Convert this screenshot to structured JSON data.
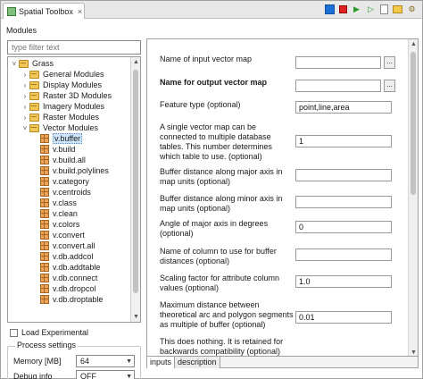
{
  "window": {
    "title": "Spatial Toolbox",
    "close": "×"
  },
  "toolbar_icons": [
    "select-icon",
    "stop-icon",
    "run-icon",
    "run-console-icon",
    "document-icon",
    "folder-icon",
    "gear-icon"
  ],
  "left": {
    "modules_label": "Modules",
    "filter_placeholder": "type filter text",
    "tree": [
      {
        "label": "Grass",
        "level": 0,
        "kind": "folder",
        "expanded": true
      },
      {
        "label": "General Modules",
        "level": 1,
        "kind": "folder",
        "expanded": false
      },
      {
        "label": "Display Modules",
        "level": 1,
        "kind": "folder",
        "expanded": false
      },
      {
        "label": "Raster 3D Modules",
        "level": 1,
        "kind": "folder",
        "expanded": false
      },
      {
        "label": "Imagery Modules",
        "level": 1,
        "kind": "folder",
        "expanded": false
      },
      {
        "label": "Raster Modules",
        "level": 1,
        "kind": "folder",
        "expanded": false
      },
      {
        "label": "Vector Modules",
        "level": 1,
        "kind": "folder",
        "expanded": true
      },
      {
        "label": "v.buffer",
        "level": 2,
        "kind": "module",
        "selected": true
      },
      {
        "label": "v.build",
        "level": 2,
        "kind": "module"
      },
      {
        "label": "v.build.all",
        "level": 2,
        "kind": "module"
      },
      {
        "label": "v.build.polylines",
        "level": 2,
        "kind": "module"
      },
      {
        "label": "v.category",
        "level": 2,
        "kind": "module"
      },
      {
        "label": "v.centroids",
        "level": 2,
        "kind": "module"
      },
      {
        "label": "v.class",
        "level": 2,
        "kind": "module"
      },
      {
        "label": "v.clean",
        "level": 2,
        "kind": "module"
      },
      {
        "label": "v.colors",
        "level": 2,
        "kind": "module"
      },
      {
        "label": "v.convert",
        "level": 2,
        "kind": "module"
      },
      {
        "label": "v.convert.all",
        "level": 2,
        "kind": "module"
      },
      {
        "label": "v.db.addcol",
        "level": 2,
        "kind": "module"
      },
      {
        "label": "v.db.addtable",
        "level": 2,
        "kind": "module"
      },
      {
        "label": "v.db.connect",
        "level": 2,
        "kind": "module"
      },
      {
        "label": "v.db.dropcol",
        "level": 2,
        "kind": "module"
      },
      {
        "label": "v.db.droptable",
        "level": 2,
        "kind": "module"
      }
    ],
    "load_experimental": "Load Experimental",
    "process_settings": "Process settings",
    "memory_label": "Memory [MB]",
    "memory_value": "64",
    "debug_label": "Debug info",
    "debug_value": "OFF"
  },
  "params": [
    {
      "label": "Name of input vector map",
      "value": "",
      "browse": true,
      "bold": false
    },
    {
      "label": "Name for output vector map",
      "value": "",
      "browse": true,
      "bold": true
    },
    {
      "label": "Feature type (optional)",
      "value": "point,line,area",
      "browse": false,
      "bold": false
    },
    {
      "label": "A single vector map can be connected to multiple database tables. This number determines which table to use. (optional)",
      "value": "1",
      "browse": false,
      "bold": false
    },
    {
      "label": "Buffer distance along major axis in map units (optional)",
      "value": "",
      "browse": false,
      "bold": false
    },
    {
      "label": "Buffer distance along minor axis in map units (optional)",
      "value": "",
      "browse": false,
      "bold": false
    },
    {
      "label": "Angle of major axis in degrees (optional)",
      "value": "0",
      "browse": false,
      "bold": false
    },
    {
      "label": "Name of column to use for buffer distances (optional)",
      "value": "",
      "browse": false,
      "bold": false
    },
    {
      "label": "Scaling factor for attribute column values (optional)",
      "value": "1.0",
      "browse": false,
      "bold": false
    },
    {
      "label": "Maximum distance between theoretical arc and polygon segments as multiple of buffer (optional)",
      "value": "0.01",
      "browse": false,
      "bold": false
    },
    {
      "label": "This does nothing. It is retained for backwards compatibility (optional)",
      "value": "",
      "browse": false,
      "bold": false
    }
  ],
  "bottom_tabs": [
    "inputs",
    "description"
  ],
  "browse_label": "..."
}
